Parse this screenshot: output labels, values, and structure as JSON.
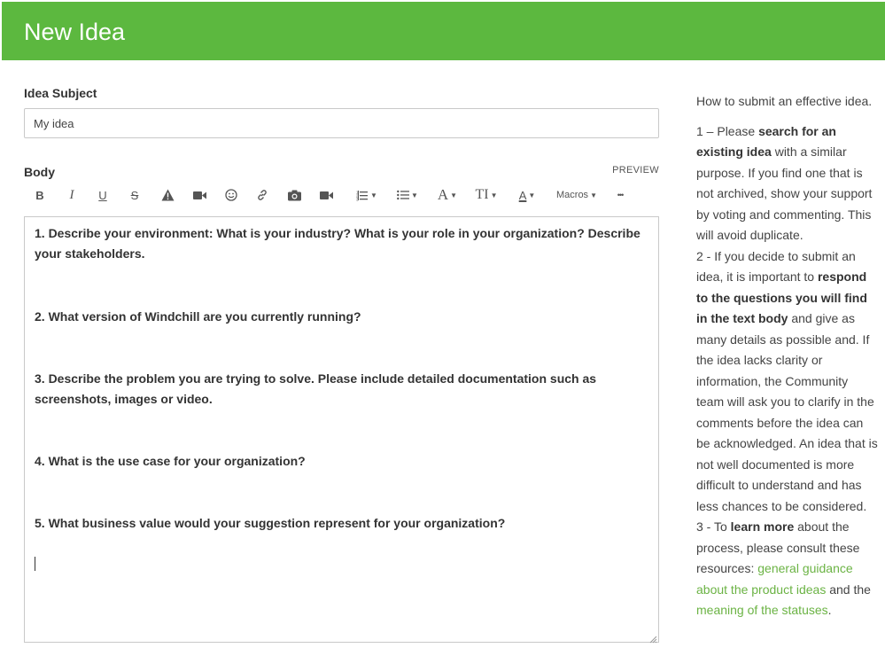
{
  "header": {
    "title": "New Idea"
  },
  "form": {
    "subject_label": "Idea Subject",
    "subject_value": "My idea",
    "body_label": "Body",
    "preview_label": "PREVIEW"
  },
  "toolbar": {
    "bold_label": "B",
    "italic_label": "I",
    "underline_label": "U",
    "strike_label": "S",
    "font_label": "A",
    "textsize_label": "TI",
    "fontcolor_label": "A",
    "macros_label": "Macros",
    "more_label": "•••",
    "icons": [
      "bold",
      "italic",
      "underline",
      "strikethrough",
      "warning-icon",
      "video-icon",
      "emoji-icon",
      "link-icon",
      "camera-icon",
      "video-record-icon",
      "ordered-list-icon",
      "unordered-list-icon",
      "font-family-icon",
      "text-size-icon",
      "font-color-icon",
      "macros-menu",
      "more-icon"
    ]
  },
  "editor": {
    "q1": "1. Describe your environment: What is your industry? What is your role in your organization? Describe your stakeholders.",
    "q2": "2. What version of Windchill are you currently running?",
    "q3": "3. Describe the problem you are trying to solve. Please include detailed documentation such as screenshots, images or video.",
    "q4": "4. What is the use case for your organization?",
    "q5": "5. What business value would your suggestion represent for your organization?"
  },
  "sidebar": {
    "intro": "How to submit an effective idea.",
    "s1_a": "1 – Please ",
    "s1_b": "search for an existing idea",
    "s1_c": " with a similar purpose. If you find one that is not archived, show your support by voting and commenting. This will avoid duplicate.",
    "s2_a": "2 - If you decide to submit an idea, it is important to ",
    "s2_b": "respond to the questions you will find in the text body",
    "s2_c": " and give as many details as possible and. If the idea lacks clarity or information, the Community team will ask you to clarify in the comments before the idea can be acknowledged. An idea that is not well documented is more difficult to understand and has less chances to be considered.",
    "s3_a": "3 - To ",
    "s3_b": "learn more",
    "s3_c": " about the process, please consult these resources: ",
    "link1": "general guidance about the product ideas",
    "s3_d": " and the ",
    "link2": "meaning of the statuses",
    "s3_e": "."
  },
  "colors": {
    "header_bg": "#5cb83f",
    "link": "#6bb344",
    "border": "#c9c9c9"
  }
}
